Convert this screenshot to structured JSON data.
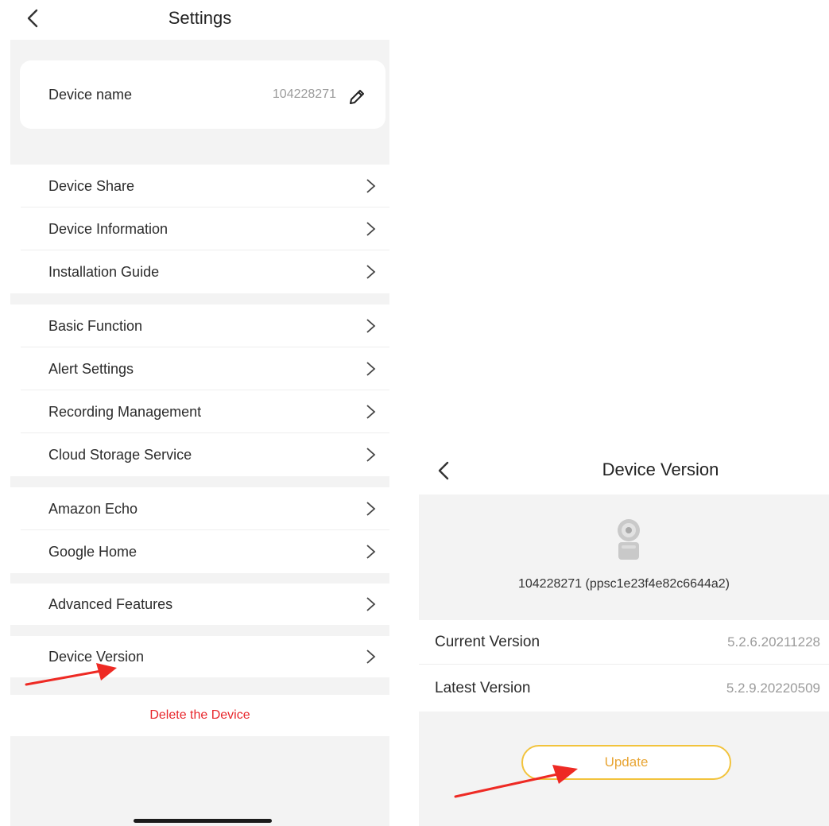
{
  "settings": {
    "title": "Settings",
    "device_name_label": "Device name",
    "device_name_value": "104228271",
    "groups": [
      [
        "Device Share",
        "Device Information",
        "Installation Guide"
      ],
      [
        "Basic Function",
        "Alert Settings",
        "Recording Management",
        "Cloud Storage Service"
      ],
      [
        "Amazon Echo",
        "Google Home"
      ],
      [
        "Advanced Features"
      ],
      [
        "Device Version"
      ]
    ],
    "delete_label": "Delete the Device"
  },
  "device_version": {
    "title": "Device Version",
    "device_id": "104228271 (ppsc1e23f4e82c6644a2)",
    "current_version_label": "Current Version",
    "current_version_value": "5.2.6.20211228",
    "latest_version_label": "Latest Version",
    "latest_version_value": "5.2.9.20220509",
    "update_label": "Update"
  },
  "colors": {
    "page_gray": "#f3f3f3",
    "delete_red": "#e8262b",
    "update_border": "#f2c33c",
    "update_text": "#e8a534",
    "annotation_arrow": "#ee2a24"
  },
  "icons": [
    "back-icon",
    "pencil-icon",
    "chevron-right-icon",
    "camera-icon",
    "annotation-arrow"
  ]
}
